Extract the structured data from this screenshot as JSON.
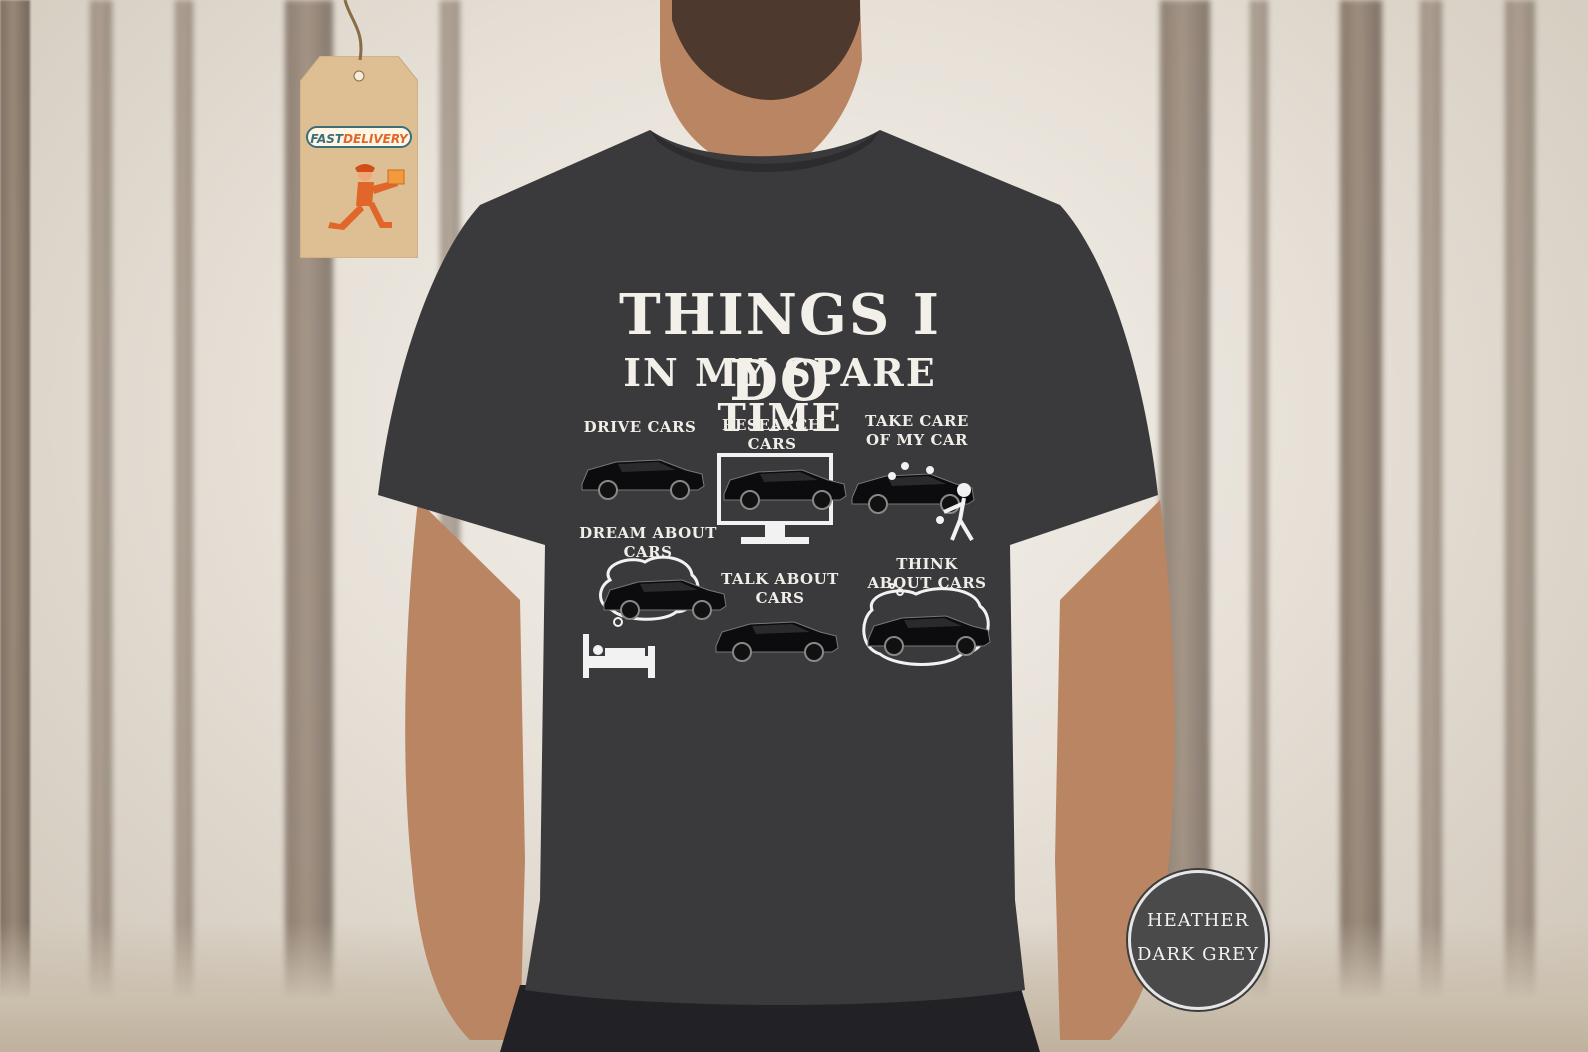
{
  "tag": {
    "fast": "FAST",
    "delivery": "DELIVERY"
  },
  "shirt": {
    "title_line1": "THINGS I DO",
    "title_line2": "IN MY SPARE TIME",
    "captions": {
      "drive": "DRIVE CARS",
      "research": "RESEARCH CARS",
      "take_care": "TAKE CARE OF MY CAR",
      "dream": "DREAM ABOUT CARS",
      "talk": "TALK ABOUT CARS",
      "think": "THINK ABOUT CARS"
    }
  },
  "color_badge": {
    "line1": "HEATHER",
    "line2": "DARK GREY"
  },
  "colors": {
    "shirt": "#3a3a3c",
    "badge": "#4a4a4a",
    "accent_orange": "#e0662a",
    "accent_teal": "#3b6e78"
  },
  "icons": [
    "delivery-runner-icon",
    "car-icon",
    "monitor-icon",
    "thought-bubble-icon",
    "bed-icon",
    "washer-person-icon"
  ]
}
